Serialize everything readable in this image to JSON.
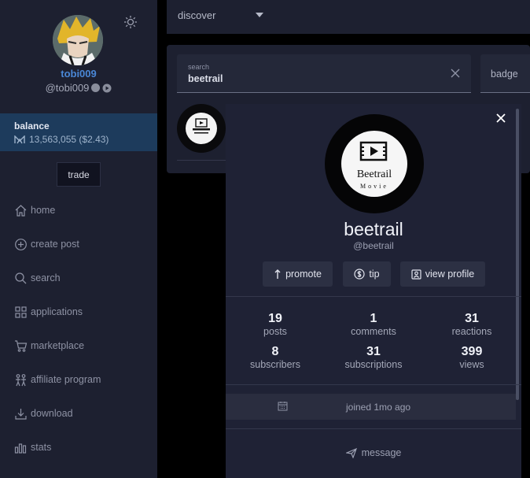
{
  "sidebar": {
    "username": "tobi009",
    "handle": "@tobi009",
    "balance_label": "balance",
    "balance_value": "13,563,055 ($2.43)",
    "trade_label": "trade",
    "nav": [
      {
        "label": "home",
        "icon": "home-icon"
      },
      {
        "label": "create post",
        "icon": "plus-circle-icon"
      },
      {
        "label": "search",
        "icon": "search-icon"
      },
      {
        "label": "applications",
        "icon": "grid-icon"
      },
      {
        "label": "marketplace",
        "icon": "cart-icon"
      },
      {
        "label": "affiliate program",
        "icon": "people-icon"
      },
      {
        "label": "download",
        "icon": "download-icon"
      },
      {
        "label": "stats",
        "icon": "bar-chart-icon"
      }
    ]
  },
  "topbar": {
    "discover_label": "discover"
  },
  "search": {
    "caption": "search",
    "value": "beetrail",
    "badge_label": "badge"
  },
  "profile": {
    "logo_text": "Beetrail",
    "logo_subtext": "Movie",
    "name": "beetrail",
    "handle": "@beetrail",
    "actions": {
      "promote": "promote",
      "tip": "tip",
      "view_profile": "view profile"
    },
    "stats": [
      {
        "value": "19",
        "label": "posts"
      },
      {
        "value": "1",
        "label": "comments"
      },
      {
        "value": "31",
        "label": "reactions"
      },
      {
        "value": "8",
        "label": "subscribers"
      },
      {
        "value": "31",
        "label": "subscriptions"
      },
      {
        "value": "399",
        "label": "views"
      }
    ],
    "joined": "joined 1mo ago",
    "message_label": "message"
  },
  "colors": {
    "accent_blue": "#4a87d6",
    "balance_bg": "#1d3b5c",
    "sidebar_bg": "#1d2030",
    "card_bg": "#1f2235"
  }
}
